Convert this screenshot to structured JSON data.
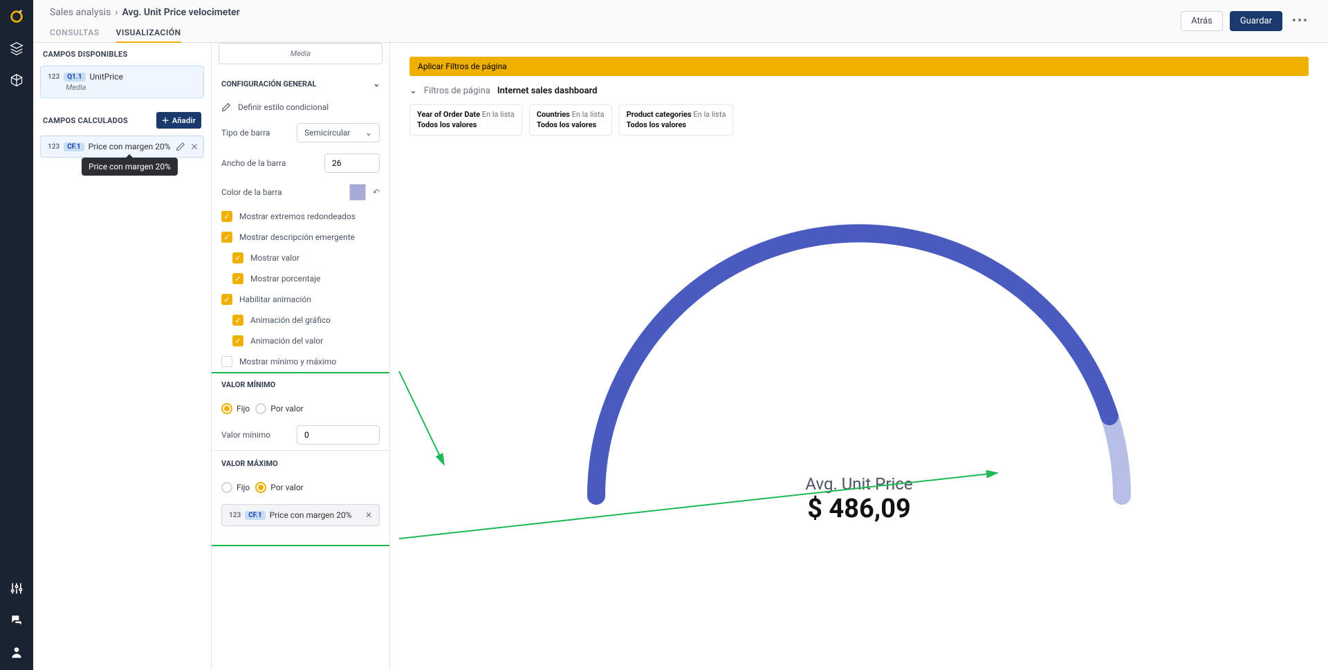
{
  "breadcrumb": {
    "parent": "Sales analysis",
    "current": "Avg. Unit Price velocimeter"
  },
  "tabs": {
    "queries": "CONSULTAS",
    "viz": "VISUALIZACIÓN"
  },
  "actions": {
    "back": "Atrás",
    "save": "Guardar"
  },
  "leftPanel": {
    "available": "CAMPOS DISPONIBLES",
    "calculated": "CAMPOS CALCULADOS",
    "add": "Añadir",
    "field1": {
      "type": "123",
      "pill": "Q1.1",
      "name": "UnitPrice",
      "sub": "Media"
    },
    "field2": {
      "type": "123",
      "pill": "CF.1",
      "name": "Price con margen 20%"
    },
    "tooltip": "Price con margen 20%"
  },
  "config": {
    "mediaLabel": "Media",
    "general": "CONFIGURACIÓN GENERAL",
    "condStyle": "Definir estilo condicional",
    "barType": {
      "label": "Tipo de barra",
      "value": "Semicircular"
    },
    "barWidth": {
      "label": "Ancho de la barra",
      "value": "26"
    },
    "barColor": "Color de la barra",
    "ck": {
      "rounded": "Mostrar extremos redondeados",
      "tooltip": "Mostrar descripción emergente",
      "showVal": "Mostrar valor",
      "showPct": "Mostrar porcentaje",
      "anim": "Habilitar animación",
      "animChart": "Animación del gráfico",
      "animVal": "Animación del valor",
      "minmax": "Mostrar mínimo y máximo"
    },
    "min": {
      "title": "VALOR MÍNIMO",
      "fixed": "Fijo",
      "byVal": "Por valor",
      "label": "Valor mínimo",
      "value": "0"
    },
    "max": {
      "title": "VALOR MÁXIMO",
      "fixed": "Fijo",
      "byVal": "Por valor",
      "field": {
        "type": "123",
        "pill": "CF.1",
        "name": "Price con margen 20%"
      }
    }
  },
  "filters": {
    "apply": "Aplicar Filtros de página",
    "label": "Filtros de página",
    "dashboard": "Internet sales dashboard",
    "f1": {
      "a": "Year of Order Date",
      "b": "En la lista",
      "c": "Todos los valores"
    },
    "f2": {
      "a": "Countries",
      "b": "En la lista",
      "c": "Todos los valores"
    },
    "f3": {
      "a": "Product categories",
      "b": "En la lista",
      "c": "Todos los valores"
    }
  },
  "chart": {
    "title": "Avg. Unit Price",
    "value": "$ 486,09"
  },
  "chart_data": {
    "type": "gauge",
    "title": "Avg. Unit Price",
    "value": 486.09,
    "value_display": "$ 486,09",
    "min": 0,
    "max_source": "Price con margen 20%",
    "fill_fraction": 0.92,
    "bar_color": "#4a5bbf",
    "track_color": "#b8bfe6"
  }
}
